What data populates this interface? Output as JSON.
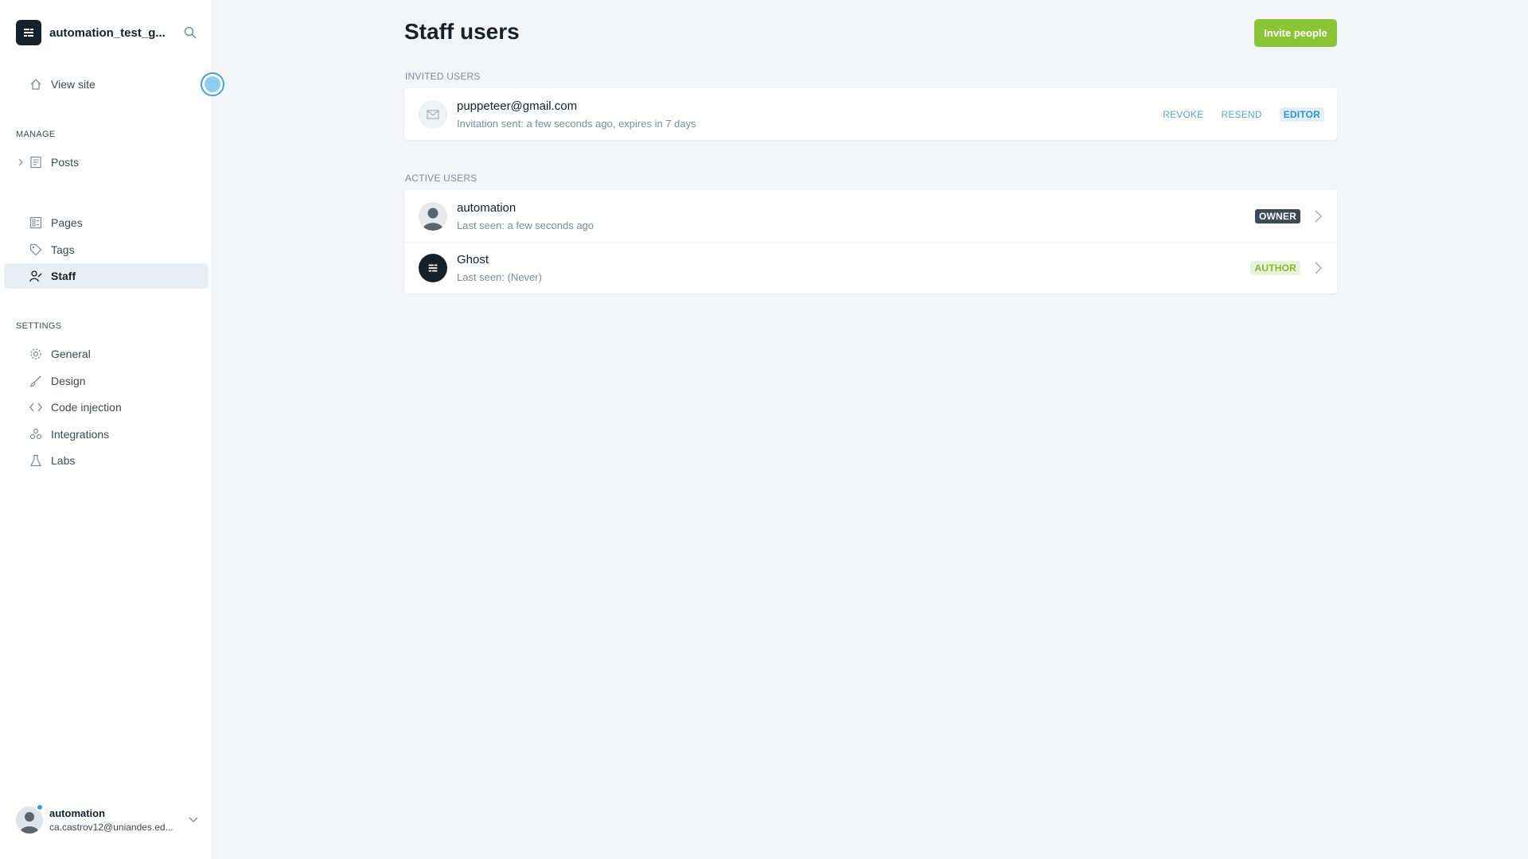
{
  "sidebar": {
    "site_title": "automation_test_g...",
    "view_site": "View site",
    "manage_label": "MANAGE",
    "settings_label": "SETTINGS",
    "manage_items": {
      "posts": "Posts",
      "pages": "Pages",
      "tags": "Tags",
      "staff": "Staff"
    },
    "settings_items": {
      "general": "General",
      "design": "Design",
      "code_injection": "Code injection",
      "integrations": "Integrations",
      "labs": "Labs"
    },
    "user": {
      "name": "automation",
      "email": "ca.castrov12@uniandes.ed..."
    }
  },
  "main": {
    "title": "Staff users",
    "invite_button": "Invite people",
    "invited": {
      "label": "INVITED USERS",
      "users": [
        {
          "email": "puppeteer@gmail.com",
          "status": "Invitation sent: a few seconds ago, expires in 7 days",
          "revoke": "REVOKE",
          "resend": "RESEND",
          "role": "EDITOR"
        }
      ]
    },
    "active": {
      "label": "ACTIVE USERS",
      "users": [
        {
          "name": "automation",
          "last_seen": "Last seen: a few seconds ago",
          "role": "OWNER"
        },
        {
          "name": "Ghost",
          "last_seen": "Last seen: (Never)",
          "role": "AUTHOR"
        }
      ]
    }
  },
  "colors": {
    "accent_green": "#8ac437",
    "link_blue": "#5ba4cf",
    "owner_tag": "#3e4a54",
    "author_tag": "#8ab33a",
    "background": "#f4f5f6"
  },
  "icons": {
    "brand": "ghost-logo-icon",
    "search": "search-icon",
    "view_site": "home-icon",
    "posts": "posts-icon",
    "pages": "pages-icon",
    "tags": "tag-icon",
    "staff": "staff-icon",
    "general": "gear-icon",
    "design": "brush-icon",
    "code_injection": "code-icon",
    "integrations": "integrations-icon",
    "labs": "flask-icon"
  }
}
